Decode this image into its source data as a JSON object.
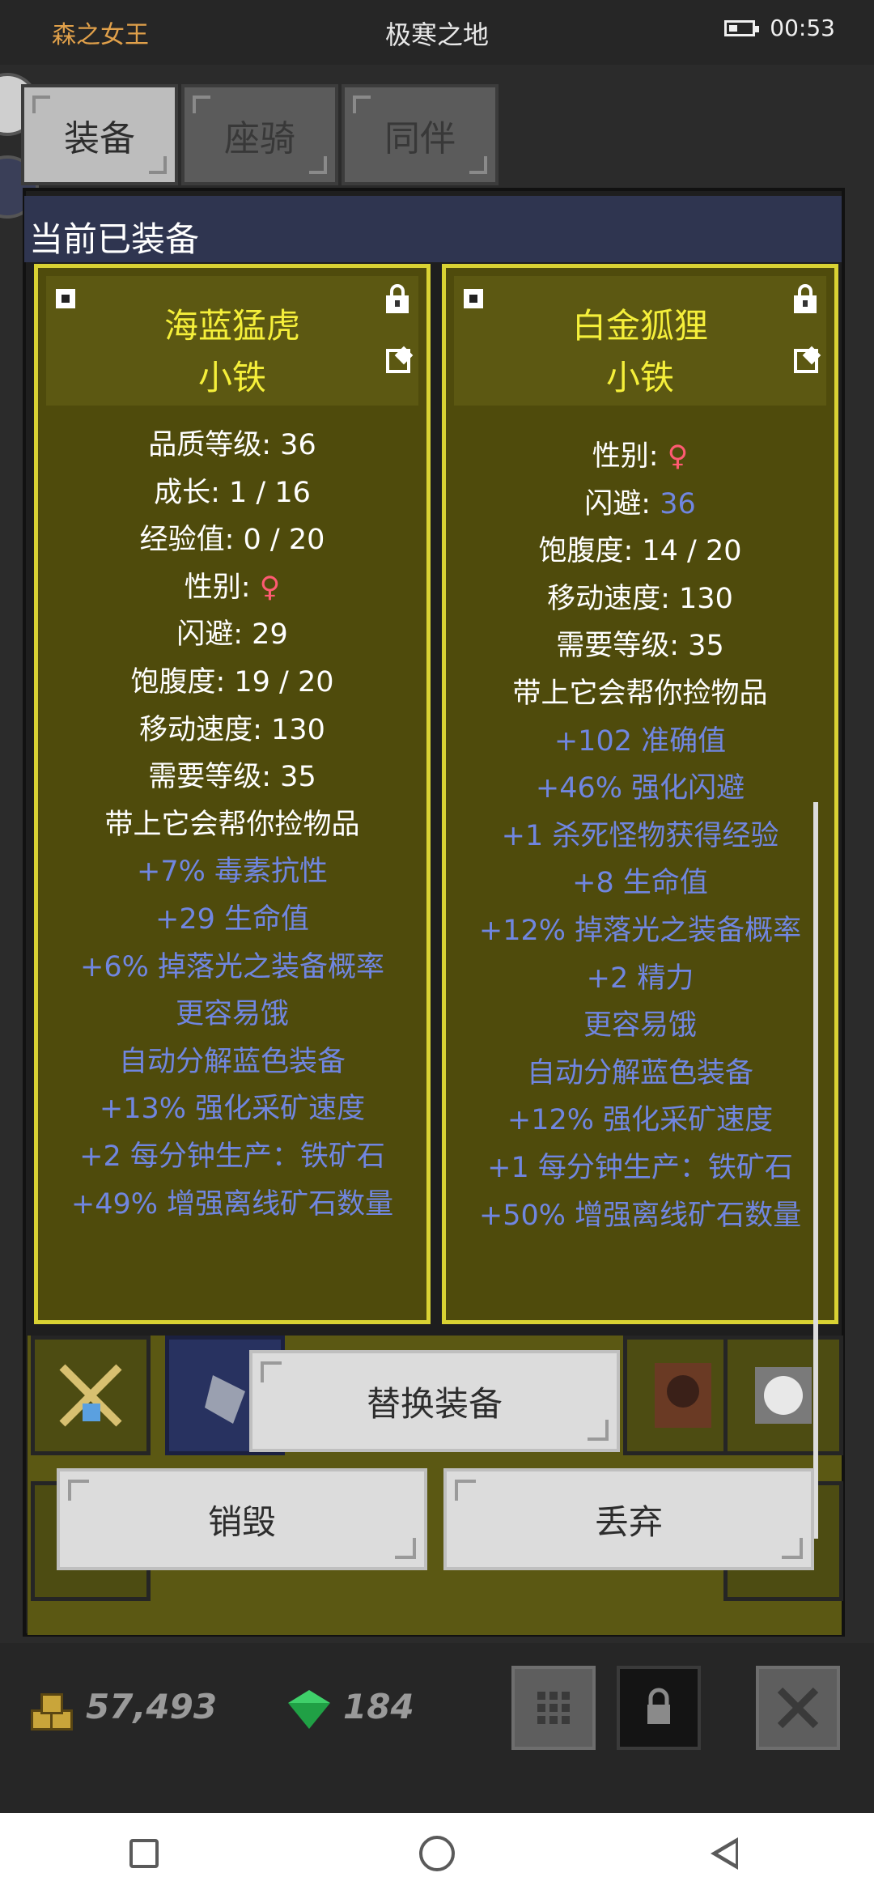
{
  "status_bar": {
    "left_title": "森之女王",
    "center_title": "极寒之地",
    "time": "00:53"
  },
  "tabs": [
    {
      "label": "装备"
    },
    {
      "label": "座骑"
    },
    {
      "label": "同伴"
    }
  ],
  "equipped_title": "当前已装备",
  "left_card": {
    "name": "海蓝猛虎",
    "sub": "小铁",
    "stats": [
      "品质等级: 36",
      "成长: 1 / 16",
      "经验值: 0 / 20",
      "闪避: 29",
      "饱腹度: 19 / 20",
      "移动速度: 130",
      "需要等级: 35",
      "带上它会帮你捡物品"
    ],
    "gender_label": "性别: ",
    "gender_symbol": "♀",
    "bonuses": [
      "+7% 毒素抗性",
      "+29 生命值",
      "+6% 掉落光之装备概率",
      "更容易饿",
      "自动分解蓝色装备",
      "+13% 强化采矿速度",
      "+2 每分钟生产：铁矿石",
      "+49% 增强离线矿石数量"
    ]
  },
  "right_card": {
    "name": "白金狐狸",
    "sub": "小铁",
    "gender_label": "性别: ",
    "gender_symbol": "♀",
    "dodge_label": "闪避: ",
    "dodge_value": "36",
    "stats": [
      "饱腹度: 14 / 20",
      "移动速度: 130",
      "需要等级: 35",
      "带上它会帮你捡物品"
    ],
    "bonuses": [
      "+102 准确值",
      "+46% 强化闪避",
      "+1 杀死怪物获得经验",
      "+8 生命值",
      "+12% 掉落光之装备概率",
      "+2 精力",
      "更容易饿",
      "自动分解蓝色装备",
      "+12% 强化采矿速度",
      "+1 每分钟生产：铁矿石",
      "+50% 增强离线矿石数量"
    ]
  },
  "actions": {
    "replace": "替换装备",
    "destroy": "销毁",
    "discard": "丢弃"
  },
  "currency": {
    "gold": "57,493",
    "gems": "184"
  },
  "icons": {
    "grid": "grid-icon",
    "lock": "lock-icon",
    "close": "close-icon"
  }
}
